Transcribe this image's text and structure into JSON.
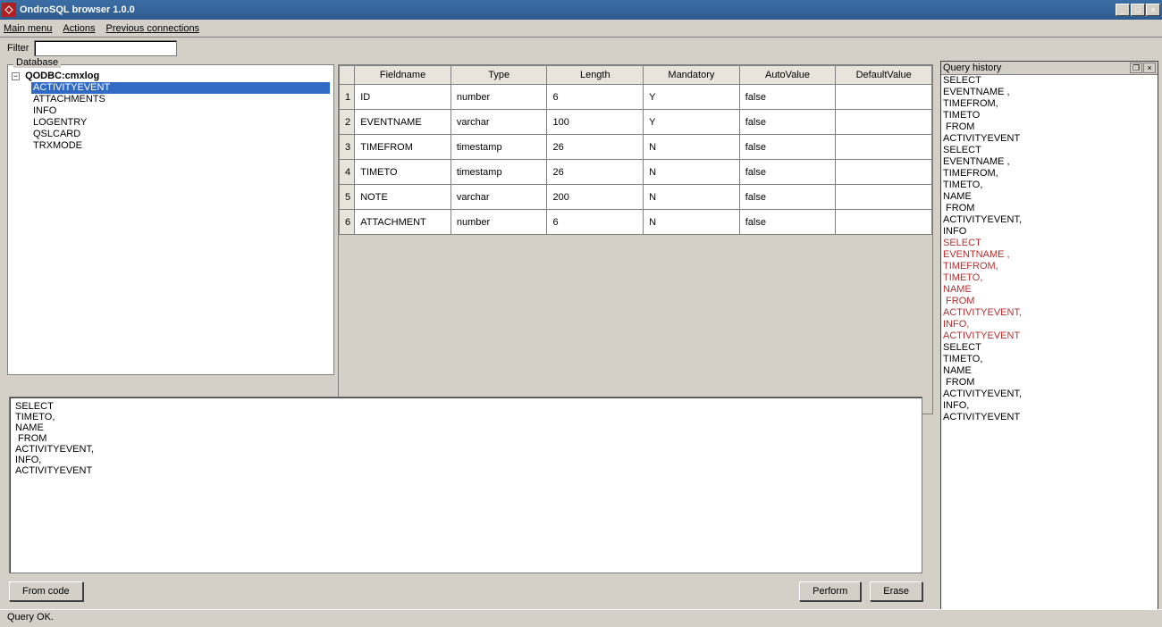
{
  "window": {
    "title": "OndroSQL browser 1.0.0"
  },
  "menu": {
    "main": "Main menu",
    "actions": "Actions",
    "previous": "Previous connections"
  },
  "filter": {
    "label": "Filter",
    "value": ""
  },
  "tree": {
    "header": "Database",
    "root": "QODBC:cmxlog",
    "children": [
      {
        "label": "ACTIVITYEVENT",
        "selected": true
      },
      {
        "label": "ATTACHMENTS",
        "selected": false
      },
      {
        "label": "INFO",
        "selected": false
      },
      {
        "label": "LOGENTRY",
        "selected": false
      },
      {
        "label": "QSLCARD",
        "selected": false
      },
      {
        "label": "TRXMODE",
        "selected": false
      }
    ]
  },
  "grid": {
    "headers": [
      "Fieldname",
      "Type",
      "Length",
      "Mandatory",
      "AutoValue",
      "DefaultValue"
    ],
    "rows": [
      {
        "n": "1",
        "c": [
          "ID",
          "number",
          "6",
          "Y",
          "false",
          ""
        ]
      },
      {
        "n": "2",
        "c": [
          "EVENTNAME",
          "varchar",
          "100",
          "Y",
          "false",
          ""
        ]
      },
      {
        "n": "3",
        "c": [
          "TIMEFROM",
          "timestamp",
          "26",
          "N",
          "false",
          ""
        ]
      },
      {
        "n": "4",
        "c": [
          "TIMETO",
          "timestamp",
          "26",
          "N",
          "false",
          ""
        ]
      },
      {
        "n": "5",
        "c": [
          "NOTE",
          "varchar",
          "200",
          "N",
          "false",
          ""
        ]
      },
      {
        "n": "6",
        "c": [
          "ATTACHMENT",
          "number",
          "6",
          "N",
          "false",
          ""
        ]
      }
    ]
  },
  "sql": {
    "text": "SELECT\nTIMETO,\nNAME\n FROM\nACTIVITYEVENT,\nINFO,\nACTIVITYEVENT"
  },
  "buttons": {
    "fromcode": "From code",
    "perform": "Perform",
    "erase": "Erase"
  },
  "history": {
    "header": "Query history",
    "items": [
      {
        "text": "SELECT\nEVENTNAME ,\nTIMEFROM,\nTIMETO\n FROM\nACTIVITYEVENT",
        "error": false
      },
      {
        "text": "SELECT\nEVENTNAME ,\nTIMEFROM,\nTIMETO,\nNAME\n FROM\nACTIVITYEVENT,\nINFO",
        "error": false
      },
      {
        "text": "SELECT\nEVENTNAME ,\nTIMEFROM,\nTIMETO,\nNAME\n FROM\nACTIVITYEVENT,\nINFO,\nACTIVITYEVENT",
        "error": true
      },
      {
        "text": "SELECT\nTIMETO,\nNAME\n FROM\nACTIVITYEVENT,\nINFO,\nACTIVITYEVENT",
        "error": false
      }
    ]
  },
  "status": {
    "text": "Query OK."
  }
}
